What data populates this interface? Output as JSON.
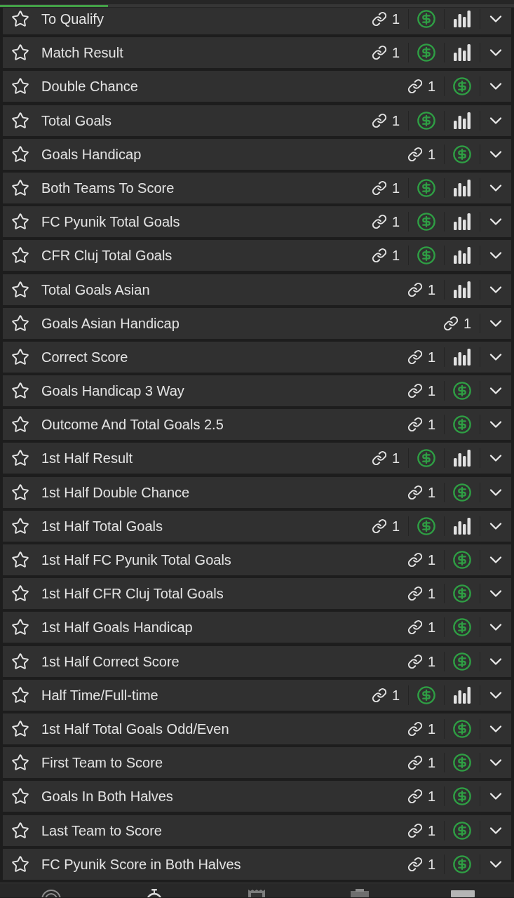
{
  "progress": {
    "level": 0.21
  },
  "markets": [
    {
      "name": "To Qualify",
      "favorite": false,
      "links": "1",
      "cash_out": true,
      "stats": true,
      "expanded": false
    },
    {
      "name": "Match Result",
      "favorite": false,
      "links": "1",
      "cash_out": true,
      "stats": true,
      "expanded": false
    },
    {
      "name": "Double Chance",
      "favorite": false,
      "links": "1",
      "cash_out": true,
      "stats": false,
      "expanded": false
    },
    {
      "name": "Total Goals",
      "favorite": false,
      "links": "1",
      "cash_out": true,
      "stats": true,
      "expanded": false
    },
    {
      "name": "Goals Handicap",
      "favorite": false,
      "links": "1",
      "cash_out": true,
      "stats": false,
      "expanded": false
    },
    {
      "name": "Both Teams To Score",
      "favorite": false,
      "links": "1",
      "cash_out": true,
      "stats": true,
      "expanded": false
    },
    {
      "name": "FC Pyunik Total Goals",
      "favorite": false,
      "links": "1",
      "cash_out": true,
      "stats": true,
      "expanded": false
    },
    {
      "name": "CFR Cluj Total Goals",
      "favorite": false,
      "links": "1",
      "cash_out": true,
      "stats": true,
      "expanded": false
    },
    {
      "name": "Total Goals Asian",
      "favorite": false,
      "links": "1",
      "cash_out": false,
      "stats": true,
      "expanded": false
    },
    {
      "name": "Goals Asian Handicap",
      "favorite": false,
      "links": "1",
      "cash_out": false,
      "stats": false,
      "expanded": false
    },
    {
      "name": "Correct Score",
      "favorite": false,
      "links": "1",
      "cash_out": false,
      "stats": true,
      "expanded": false
    },
    {
      "name": "Goals Handicap 3 Way",
      "favorite": false,
      "links": "1",
      "cash_out": true,
      "stats": false,
      "expanded": false
    },
    {
      "name": "Outcome And Total Goals 2.5",
      "favorite": false,
      "links": "1",
      "cash_out": true,
      "stats": false,
      "expanded": false
    },
    {
      "name": "1st Half Result",
      "favorite": false,
      "links": "1",
      "cash_out": true,
      "stats": true,
      "expanded": false
    },
    {
      "name": "1st Half Double Chance",
      "favorite": false,
      "links": "1",
      "cash_out": true,
      "stats": false,
      "expanded": false
    },
    {
      "name": "1st Half Total Goals",
      "favorite": false,
      "links": "1",
      "cash_out": true,
      "stats": true,
      "expanded": false
    },
    {
      "name": "1st Half FC Pyunik Total Goals",
      "favorite": false,
      "links": "1",
      "cash_out": true,
      "stats": false,
      "expanded": false
    },
    {
      "name": "1st Half CFR Cluj Total Goals",
      "favorite": false,
      "links": "1",
      "cash_out": true,
      "stats": false,
      "expanded": false
    },
    {
      "name": "1st Half Goals Handicap",
      "favorite": false,
      "links": "1",
      "cash_out": true,
      "stats": false,
      "expanded": false
    },
    {
      "name": "1st Half Correct Score",
      "favorite": false,
      "links": "1",
      "cash_out": true,
      "stats": false,
      "expanded": false
    },
    {
      "name": "Half Time/Full-time",
      "favorite": false,
      "links": "1",
      "cash_out": true,
      "stats": true,
      "expanded": false
    },
    {
      "name": "1st Half Total Goals Odd/Even",
      "favorite": false,
      "links": "1",
      "cash_out": true,
      "stats": false,
      "expanded": false
    },
    {
      "name": "First Team to Score",
      "favorite": false,
      "links": "1",
      "cash_out": true,
      "stats": false,
      "expanded": false
    },
    {
      "name": "Goals In Both Halves",
      "favorite": false,
      "links": "1",
      "cash_out": true,
      "stats": false,
      "expanded": false
    },
    {
      "name": "Last Team to Score",
      "favorite": false,
      "links": "1",
      "cash_out": true,
      "stats": false,
      "expanded": false
    },
    {
      "name": "FC Pyunik Score in Both Halves",
      "favorite": false,
      "links": "1",
      "cash_out": true,
      "stats": false,
      "expanded": false
    }
  ]
}
